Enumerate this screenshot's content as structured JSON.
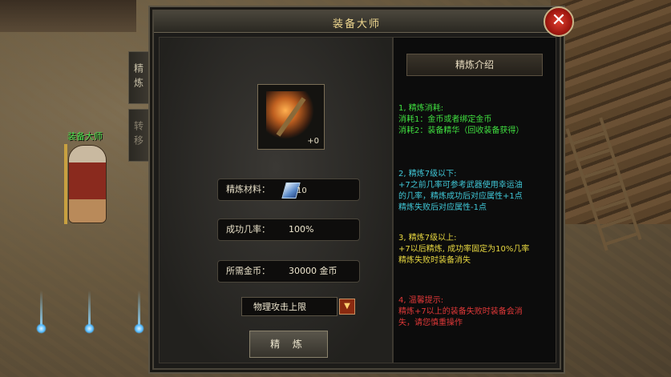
{
  "npc": {
    "name": "装备大师"
  },
  "window": {
    "title": "装备大师",
    "close_symbol": "✕"
  },
  "tabs": [
    {
      "label": "精炼"
    },
    {
      "label": "转移"
    }
  ],
  "item": {
    "level": "+0"
  },
  "fields": {
    "material": {
      "label": "精炼材料：",
      "count": "10"
    },
    "success_rate": {
      "label": "成功几率：",
      "value": "100%"
    },
    "gold": {
      "label": "所需金币：",
      "value": "30000  金币"
    }
  },
  "attribute_select": {
    "selected": "物理攻击上限",
    "arrow": "▼"
  },
  "refine_button": {
    "label": "精 炼"
  },
  "intro": {
    "title": "精炼介绍",
    "sections": [
      {
        "text": "1, 精炼消耗:\n消耗1：金币或者绑定金币\n消耗2：装备精华（回收装备获得）",
        "color": "#40e040"
      },
      {
        "text": "2, 精炼7级以下:\n+7之前几率可参考武器使用幸运油\n的几率，精炼成功后对应属性+1点\n精炼失败后对应属性-1点",
        "color": "#40c8d8"
      },
      {
        "text": "3, 精炼7级以上:\n+7以后精炼, 成功率固定为10%几率\n精炼失败时装备消失",
        "color": "#e8d840"
      },
      {
        "text": "4, 温馨提示:\n精炼+7以上的装备失败时装备会消\n失，请您慎重操作",
        "color": "#e03838"
      }
    ]
  }
}
